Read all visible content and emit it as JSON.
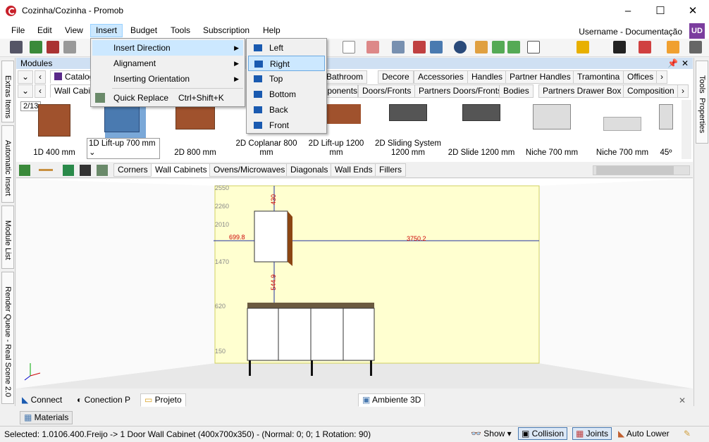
{
  "window": {
    "title": "Cozinha/Cozinha - Promob",
    "minimize": "–",
    "maximize": "☐",
    "close": "✕"
  },
  "menubar": {
    "items": [
      "File",
      "Edit",
      "View",
      "Insert",
      "Budget",
      "Tools",
      "Subscription",
      "Help"
    ],
    "user": "Username - Documentação",
    "avatar": "UD"
  },
  "modules": {
    "title": "Modules",
    "pin": "📌",
    "close": "✕",
    "tabs_row1": [
      "Catalog",
      "Bathroom",
      "Decore",
      "Accessories",
      "Handles",
      "Partner Handles",
      "Tramontina",
      "Offices"
    ],
    "tabs_row2": [
      "Wall Cabinets",
      "Components",
      "Doors/Fronts",
      "Partners Doors/Fronts",
      "Bodies",
      "Partners Drawer Box",
      "Composition"
    ],
    "page": "2/13",
    "items": [
      {
        "label": "1D 400 mm"
      },
      {
        "label": "1D Lift-up 700 mm"
      },
      {
        "label": "2D 800 mm"
      },
      {
        "label": "2D Coplanar 800 mm"
      },
      {
        "label": "2D Lift-up 1200 mm"
      },
      {
        "label": "2D Sliding System 1200 mm"
      },
      {
        "label": "2D Slide 1200 mm"
      },
      {
        "label": "Niche 700 mm"
      },
      {
        "label": "Niche 700 mm"
      },
      {
        "label": "45º"
      }
    ],
    "subtabs": [
      "Corners",
      "Wall Cabinets",
      "Ovens/Microwaves",
      "Diagonals",
      "Wall Ends",
      "Fillers"
    ]
  },
  "insert_menu": {
    "items": [
      {
        "label": "Insert Direction",
        "arrow": "▶"
      },
      {
        "label": "Alignament",
        "arrow": "▶"
      },
      {
        "label": "Inserting Orientation",
        "arrow": "▶"
      },
      {
        "label": "Quick Replace",
        "shortcut": "Ctrl+Shift+K"
      }
    ]
  },
  "direction_menu": {
    "items": [
      "Left",
      "Right",
      "Top",
      "Bottom",
      "Back",
      "Front"
    ],
    "selected": "Right"
  },
  "sidebar_left": [
    "Extras Items",
    "Automatic Insert",
    "Module List",
    "Render Queue - Real Scene 2.0"
  ],
  "sidebar_right": [
    "Tools",
    "Properties"
  ],
  "viewport": {
    "dims": {
      "h2550": "2550",
      "h2260": "2260",
      "h2010": "2010",
      "h1470": "1470",
      "h620": "620",
      "h150": "150",
      "left": "699.8",
      "right": "3750.2",
      "top": "430",
      "gap": "544.9"
    }
  },
  "bottom_tabs": {
    "left": [
      "Connect",
      "Conection P",
      "Projeto"
    ],
    "right": [
      "Ambiente 3D"
    ],
    "close": "✕"
  },
  "materials_tab": "Materials",
  "status": {
    "text": "Selected: 1.0106.400.Freijo -> 1 Door Wall Cabinet (400x700x350) - (Normal: 0; 0; 1 Rotation: 90)",
    "show": "Show",
    "collision": "Collision",
    "joints": "Joints",
    "auto_lower": "Auto Lower"
  },
  "colors": {
    "accent": "#cce8ff",
    "wall": "#ffffd0",
    "cabinet_wood": "#a0522d"
  }
}
